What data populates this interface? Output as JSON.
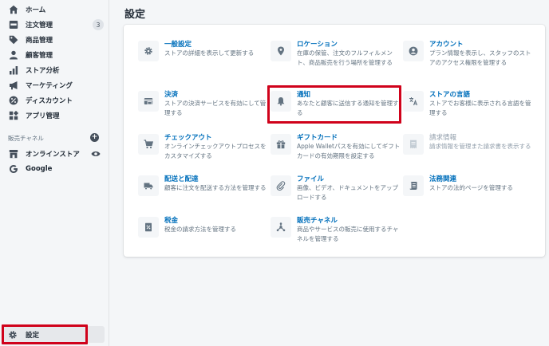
{
  "sidebar": {
    "items": [
      {
        "label": "ホーム",
        "icon": "home-icon"
      },
      {
        "label": "注文管理",
        "icon": "orders-icon",
        "badge": "3"
      },
      {
        "label": "商品管理",
        "icon": "tag-icon"
      },
      {
        "label": "顧客管理",
        "icon": "customer-icon"
      },
      {
        "label": "ストア分析",
        "icon": "analytics-icon"
      },
      {
        "label": "マーケティング",
        "icon": "megaphone-icon"
      },
      {
        "label": "ディスカウント",
        "icon": "discount-icon"
      },
      {
        "label": "アプリ管理",
        "icon": "apps-icon"
      }
    ],
    "sales_channels_label": "販売チャネル",
    "channels": [
      {
        "label": "オンラインストア",
        "icon": "store-icon"
      },
      {
        "label": "Google",
        "icon": "google-icon"
      }
    ],
    "settings_label": "設定"
  },
  "page": {
    "title": "設定"
  },
  "tiles": [
    {
      "title": "一般設定",
      "desc": "ストアの詳細を表示して更新する",
      "icon": "gear-icon"
    },
    {
      "title": "ロケーション",
      "desc": "在庫の保管、注文のフルフィルメント、商品販売を行う場所を管理する",
      "icon": "location-pin-icon"
    },
    {
      "title": "アカウント",
      "desc": "プラン情報を表示し、スタッフのストアのアクセス権限を管理する",
      "icon": "account-icon"
    },
    {
      "title": "決済",
      "desc": "ストアの決済サービスを有効にして管理する",
      "icon": "payment-icon"
    },
    {
      "title": "通知",
      "desc": "あなたと顧客に送信する通知を管理する",
      "icon": "bell-icon"
    },
    {
      "title": "ストアの言語",
      "desc": "ストアでお客様に表示される言語を管理する",
      "icon": "translate-icon"
    },
    {
      "title": "チェックアウト",
      "desc": "オンラインチェックアウトプロセスをカスタマイズする",
      "icon": "cart-icon"
    },
    {
      "title": "ギフトカード",
      "desc": "Apple Walletパスを有効にしてギフトカードの有効期限を設定する",
      "icon": "gift-icon"
    },
    {
      "title": "請求情報",
      "desc": "請求情報を管理また請求書を表示する",
      "icon": "billing-icon"
    },
    {
      "title": "配送と配達",
      "desc": "顧客に注文を配送する方法を管理する",
      "icon": "truck-icon"
    },
    {
      "title": "ファイル",
      "desc": "画像、ビデオ、ドキュメントをアップロードする",
      "icon": "paperclip-icon"
    },
    {
      "title": "法務関連",
      "desc": "ストアの法的ページを管理する",
      "icon": "legal-icon"
    },
    {
      "title": "税金",
      "desc": "税金の請求方法を管理する",
      "icon": "tax-icon"
    },
    {
      "title": "販売チャネル",
      "desc": "商品やサービスの販売に使用するチャネルを管理する",
      "icon": "channels-icon"
    }
  ],
  "colors": {
    "accent_link": "#006fbb",
    "highlight": "#d0021b",
    "muted": "#919eab"
  }
}
